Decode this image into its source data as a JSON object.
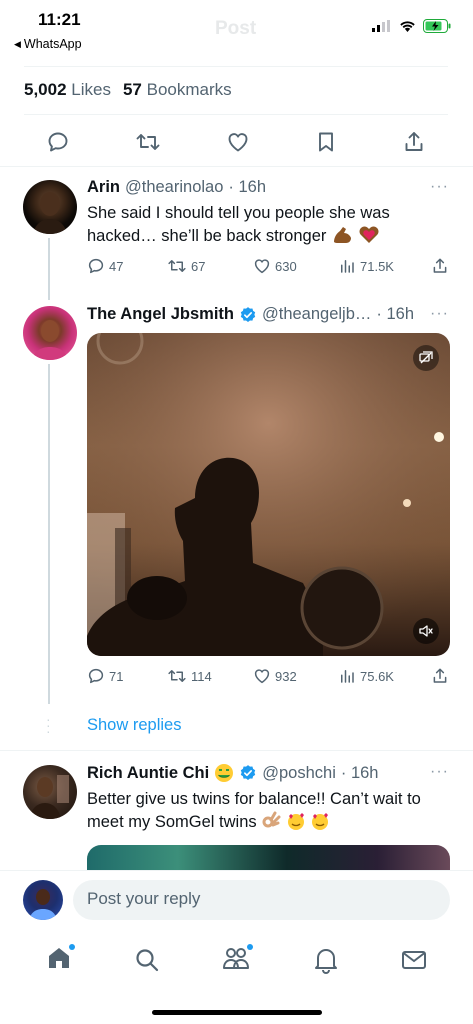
{
  "status_bar": {
    "time": "11:21",
    "back_app": "WhatsApp"
  },
  "header": {
    "ghost_title": "Post"
  },
  "main_tweet_stats": {
    "likes_count": "5,002",
    "likes_label": "Likes",
    "bookmarks_count": "57",
    "bookmarks_label": "Bookmarks"
  },
  "replies": [
    {
      "name": "Arin",
      "handle": "@thearinolao",
      "time": "· 16h",
      "text": "She said I should tell you people she was hacked… she’ll be back stronger",
      "emojis": [
        "flexed-biceps",
        "heart-hands"
      ],
      "metrics": {
        "replies": "47",
        "reposts": "67",
        "likes": "630",
        "views": "71.5K"
      }
    },
    {
      "name": "The Angel Jbsmith",
      "verified": true,
      "handle": "@theangeljb…",
      "time": "· 16h",
      "media": "video-dark-room-silhouette",
      "metrics": {
        "replies": "71",
        "reposts": "114",
        "likes": "932",
        "views": "75.6K"
      }
    },
    {
      "name": "Rich Auntie Chi",
      "verified": true,
      "handle": "@poshchi",
      "time": "· 16h",
      "text": "Better give us twins for balance!! Can’t wait to meet my SomGel twins",
      "emojis": [
        "money-mouth-face",
        "ok-hand",
        "smiling-face-with-hearts",
        "smiling-face-with-hearts"
      ]
    }
  ],
  "show_replies": "Show replies",
  "composer": {
    "placeholder": "Post your reply"
  },
  "bottom_nav": [
    "home",
    "search",
    "communities",
    "notifications",
    "messages"
  ],
  "colors": {
    "accent": "#1d9bf0",
    "text": "#0f1419",
    "secondary": "#536471",
    "divider": "#eff3f4",
    "verified": "#1d9bf0"
  }
}
